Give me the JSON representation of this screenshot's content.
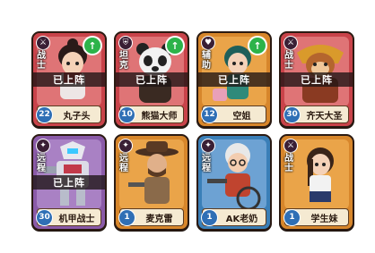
{
  "deployed_label": "已上阵",
  "cards": [
    {
      "name": "丸子头",
      "role": "战士",
      "level": "22",
      "deployed": true,
      "upgrade": true,
      "theme": "red",
      "badge_icon": "sword-icon"
    },
    {
      "name": "熊猫大师",
      "role": "坦克",
      "level": "10",
      "deployed": true,
      "upgrade": true,
      "theme": "red",
      "badge_icon": "shield-icon"
    },
    {
      "name": "空姐",
      "role": "辅助",
      "level": "12",
      "deployed": true,
      "upgrade": true,
      "theme": "orange",
      "badge_icon": "heart-icon"
    },
    {
      "name": "齐天大圣",
      "role": "战士",
      "level": "30",
      "deployed": true,
      "upgrade": false,
      "theme": "red",
      "badge_icon": "sword-icon"
    },
    {
      "name": "机甲战士",
      "role": "远程",
      "level": "30",
      "deployed": true,
      "upgrade": false,
      "theme": "purple",
      "badge_icon": "gun-icon"
    },
    {
      "name": "麦克雷",
      "role": "远程",
      "level": "1",
      "deployed": false,
      "upgrade": false,
      "theme": "orange",
      "badge_icon": "gun-icon"
    },
    {
      "name": "AK老奶",
      "role": "远程",
      "level": "1",
      "deployed": false,
      "upgrade": false,
      "theme": "orange",
      "badge_icon": "gun-icon"
    },
    {
      "name": "学生妹",
      "role": "战士",
      "level": "1",
      "deployed": false,
      "upgrade": false,
      "theme": "orange",
      "badge_icon": "sword-icon"
    }
  ],
  "colors": {
    "red": "#c9434a",
    "purple": "#8a5aa8",
    "orange": "#d7862b",
    "upgrade": "#2cb34a",
    "level": "#2f6fb5"
  }
}
